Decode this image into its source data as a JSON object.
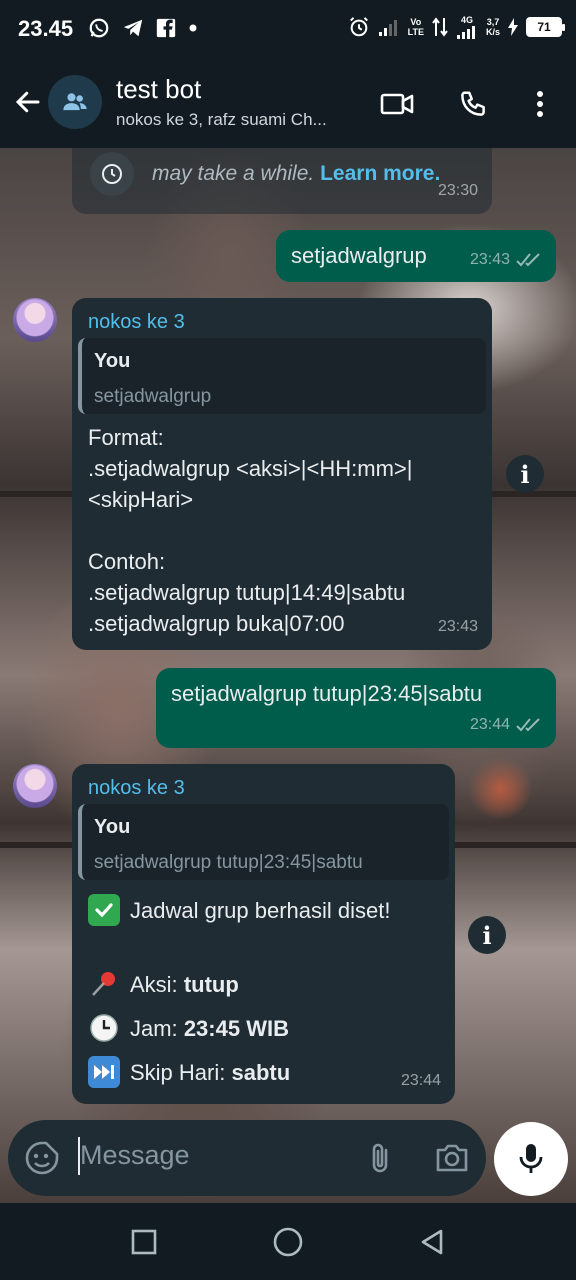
{
  "status_bar": {
    "time": "23.45",
    "network_type": "4G",
    "volte_top": "Vo",
    "volte_bottom": "LTE",
    "speed_value": "3,7",
    "speed_unit": "K/s",
    "battery": "71"
  },
  "header": {
    "title": "test bot",
    "subtitle": "nokos ke 3, rafz suami Ch..."
  },
  "messages": {
    "system": {
      "text": "may take a while.",
      "link": "Learn more.",
      "time": "23:30"
    },
    "out1": {
      "text": "setjadwalgrup",
      "time": "23:43"
    },
    "in1": {
      "sender": "nokos ke 3",
      "quote_title": "You",
      "quote_text": "setjadwalgrup",
      "body": "Format:\n.setjadwalgrup <aksi>|<HH:mm>|\n<skipHari>\n\nContoh:\n.setjadwalgrup tutup|14:49|sabtu\n.setjadwalgrup buka|07:00",
      "time": "23:43"
    },
    "out2": {
      "text": "setjadwalgrup tutup|23:45|sabtu",
      "time": "23:44"
    },
    "in2": {
      "sender": "nokos ke 3",
      "quote_title": "You",
      "quote_text": "setjadwalgrup tutup|23:45|sabtu",
      "line1": "Jadwal grup berhasil diset!",
      "aksi_label": "Aksi:",
      "aksi_value": "tutup",
      "jam_label": "Jam:",
      "jam_value": "23:45 WIB",
      "skip_label": "Skip Hari:",
      "skip_value": "sabtu",
      "time": "23:44"
    }
  },
  "composer": {
    "placeholder": "Message"
  },
  "colors": {
    "accent_link": "#53bdeb",
    "outgoing_bubble": "#005c4b",
    "incoming_bubble": "#202c33"
  }
}
